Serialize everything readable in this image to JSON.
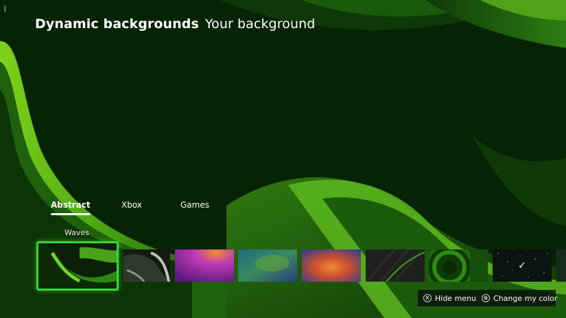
{
  "header": {
    "title": "Dynamic backgrounds",
    "subtitle": "Your background"
  },
  "tabs": [
    {
      "label": "Abstract",
      "active": true
    },
    {
      "label": "Xbox",
      "active": false
    },
    {
      "label": "Games",
      "active": false
    }
  ],
  "focused_item_label": "Waves",
  "backgrounds": [
    {
      "id": "waves",
      "selected": true,
      "icon": "waves-thumbnail"
    },
    {
      "id": "silver-waves",
      "selected": false,
      "icon": "silver-waves-thumbnail"
    },
    {
      "id": "purple-gradient",
      "selected": false,
      "icon": "purple-gradient-thumbnail"
    },
    {
      "id": "teal-blur",
      "selected": false,
      "icon": "teal-blur-thumbnail"
    },
    {
      "id": "orange-glow",
      "selected": false,
      "icon": "orange-glow-thumbnail"
    },
    {
      "id": "dark-stripes",
      "selected": false,
      "icon": "dark-stripes-thumbnail"
    },
    {
      "id": "green-rings",
      "selected": false,
      "icon": "green-rings-thumbnail"
    },
    {
      "id": "starfield",
      "selected": false,
      "icon": "starfield-thumbnail",
      "current": true
    }
  ],
  "current_check_glyph": "✓",
  "hints": {
    "hide_menu": {
      "glyph": "X",
      "label": "Hide menu"
    },
    "change_color": {
      "glyph": "⧉",
      "label": "Change my color"
    }
  },
  "colors": {
    "accent": "#3bd43b",
    "background": "#082606"
  }
}
